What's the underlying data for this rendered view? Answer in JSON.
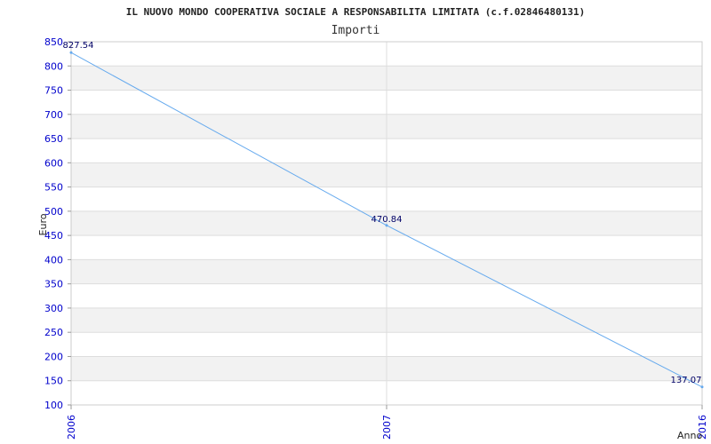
{
  "chart_data": {
    "type": "line",
    "title": "IL NUOVO MONDO COOPERATIVA SOCIALE A RESPONSABILITA LIMITATA (c.f.02846480131)",
    "subtitle": "Importi",
    "xlabel": "Anno",
    "ylabel": "Euro",
    "categories": [
      "2006",
      "2007",
      "2016"
    ],
    "series": [
      {
        "values": [
          827.54,
          470.84,
          137.07
        ],
        "labels": [
          "827.54",
          "470.84",
          "137.07"
        ]
      }
    ],
    "ylim": [
      100,
      850
    ],
    "yticks": [
      100,
      150,
      200,
      250,
      300,
      350,
      400,
      450,
      500,
      550,
      600,
      650,
      700,
      750,
      800,
      850
    ],
    "grid": true,
    "colors": {
      "line": "#66aaee",
      "band": "#f2f2f2",
      "grid": "#dddddd",
      "tick_text": "#0000cc"
    }
  }
}
